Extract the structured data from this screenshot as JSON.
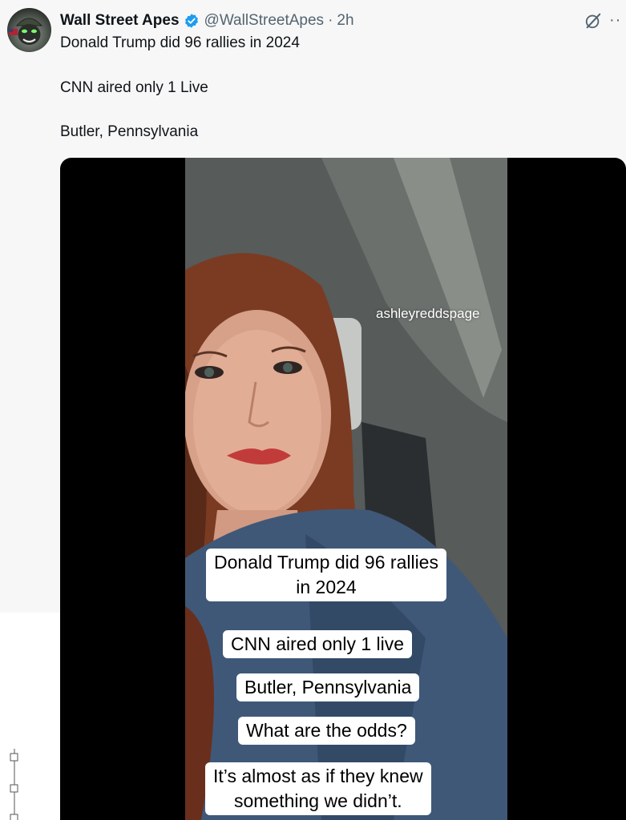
{
  "tweet": {
    "author_name": "Wall Street Apes",
    "handle": "@WallStreetApes",
    "separator": "·",
    "time": "2h",
    "more": "··",
    "text_lines": [
      "Donald Trump did 96 rallies in 2024",
      "CNN aired only 1 Live",
      "Butler, Pennsylvania"
    ],
    "icons": {
      "avatar": "gorilla-avatar",
      "verified": "verified-badge-icon",
      "grok": "grok-icon",
      "more": "more-icon"
    }
  },
  "video": {
    "watermark": "ashleyreddspage",
    "captions": [
      {
        "line1": "Donald Trump did 96 rallies",
        "line2": "in 2024"
      },
      {
        "line1": "CNN aired only 1 live"
      },
      {
        "line1": "Butler, Pennsylvania"
      },
      {
        "line1": "What are the odds?"
      },
      {
        "line1": "It’s almost as if they knew",
        "line2": "something we didn’t."
      }
    ]
  },
  "colors": {
    "verified_blue": "#1d9bf0",
    "secondary_text": "#536471",
    "primary_text": "#0f1419",
    "background": "#f7f7f7"
  }
}
